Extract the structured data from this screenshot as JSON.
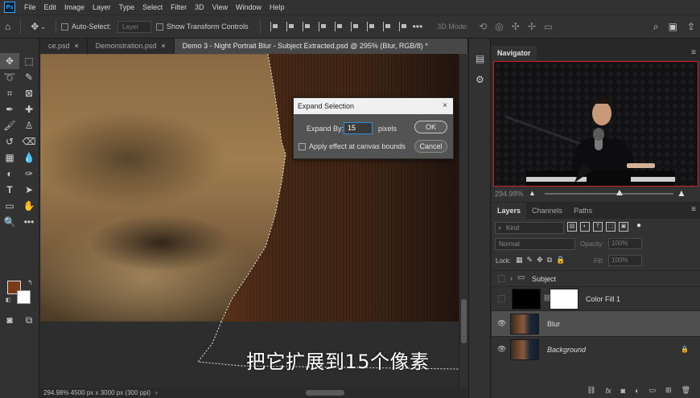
{
  "menu": {
    "app_icon": "Ps",
    "items": [
      "File",
      "Edit",
      "Image",
      "Layer",
      "Type",
      "Select",
      "Filter",
      "3D",
      "View",
      "Window",
      "Help"
    ]
  },
  "options": {
    "auto_select_label": "Auto-Select:",
    "auto_select_value": "Layer",
    "show_transform_label": "Show Transform Controls",
    "mode_label": "3D Mode:"
  },
  "tabs": [
    {
      "label": "ce.psd",
      "active": false
    },
    {
      "label": "Demonstration.psd",
      "active": false
    },
    {
      "label": "Demo 3 - Night Portrait Blur - Subject Extracted.psd @ 295% (Blur, RGB/8) *",
      "active": true
    }
  ],
  "tab_close": "×",
  "canvas": {
    "subtitle": "把它扩展到15个像素"
  },
  "status": {
    "text": "294.98%  4500 px x 3000 px (300 ppi)"
  },
  "dialog": {
    "title": "Expand Selection",
    "close": "×",
    "expand_label": "Expand By:",
    "expand_value": "15",
    "units": "pixels",
    "checkbox_label": "Apply effect at canvas bounds",
    "ok_label": "OK",
    "cancel_label": "Cancel"
  },
  "navigator": {
    "title": "Navigator",
    "zoom": "294.98%",
    "slider_fraction": 0.58
  },
  "layers": {
    "tabs": [
      "Layers",
      "Channels",
      "Paths"
    ],
    "kind_placeholder": "Kind",
    "blend_mode": "Normal",
    "opacity_label": "Opacity:",
    "opacity_value": "100%",
    "lock_label": "Lock:",
    "fill_label": "Fill:",
    "fill_value": "100%",
    "rows": [
      {
        "name": "Subject",
        "type": "group"
      },
      {
        "name": "Color Fill 1",
        "type": "fill"
      },
      {
        "name": "Blur",
        "type": "pixel",
        "selected": true
      },
      {
        "name": "Background",
        "type": "background"
      }
    ],
    "footer_icons": [
      "link-icon",
      "fx-icon",
      "mask-icon",
      "adjustment-icon",
      "group-icon",
      "new-layer-icon",
      "trash-icon"
    ],
    "footer_fx": "fx"
  },
  "colors": {
    "foreground": "#7a3a18",
    "background": "#ffffff",
    "accent": "#2e8fd4"
  }
}
